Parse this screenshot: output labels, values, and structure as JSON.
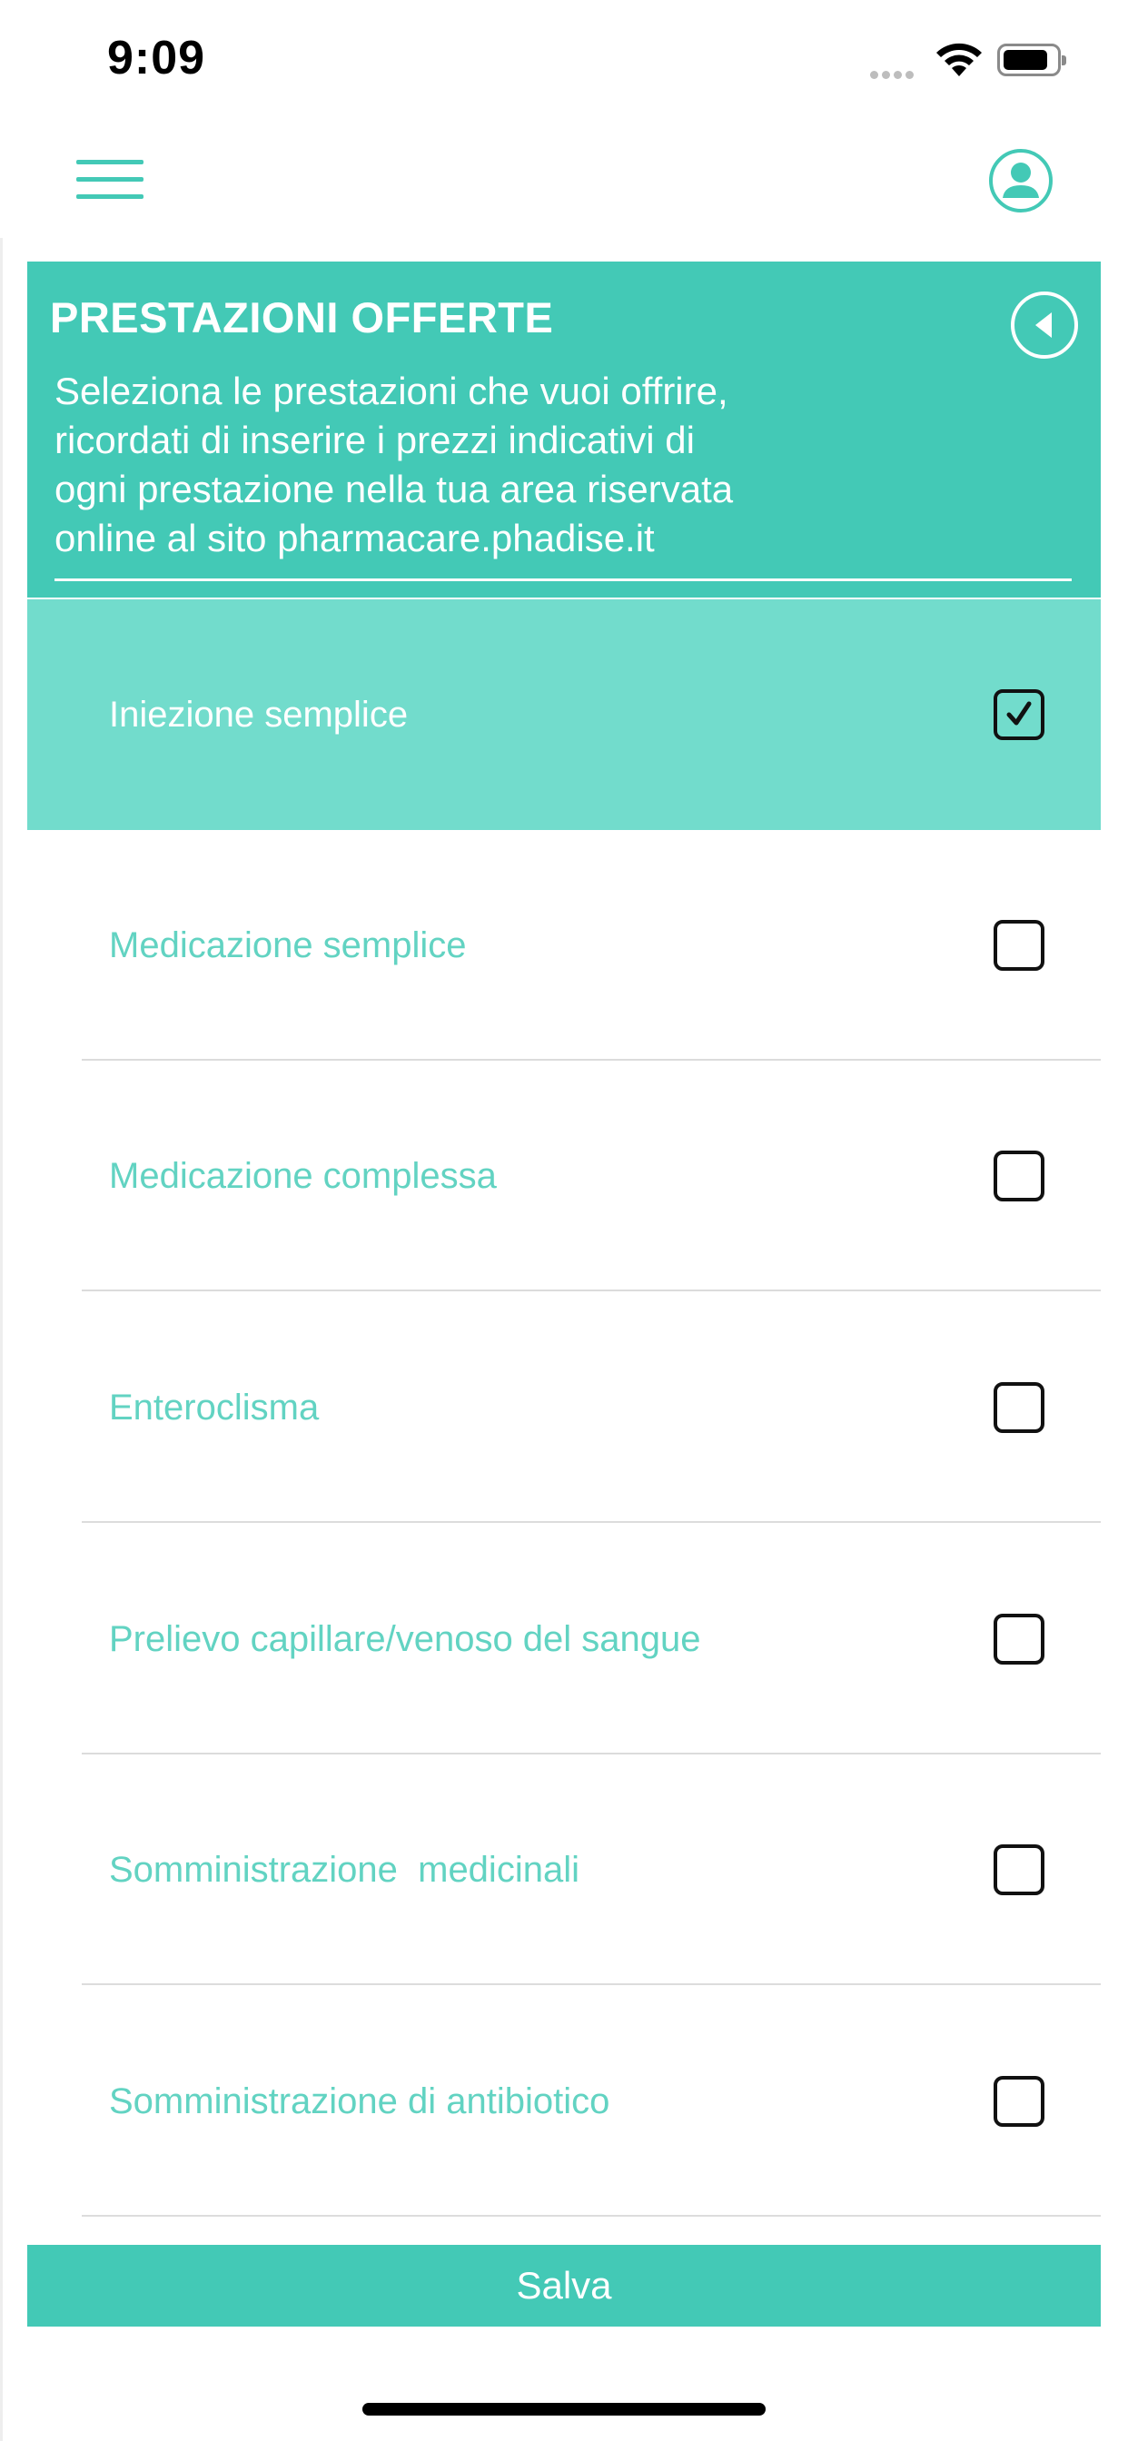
{
  "status_bar": {
    "time": "9:09"
  },
  "header": {
    "title": "PRESTAZIONI OFFERTE",
    "description": "Seleziona le prestazioni che vuoi offrire,\nricordati di inserire i prezzi indicativi di\nogni prestazione nella tua area riservata\nonline al sito pharmacare.phadise.it"
  },
  "services": [
    {
      "label": "Iniezione semplice",
      "checked": true
    },
    {
      "label": "Medicazione semplice",
      "checked": false
    },
    {
      "label": "Medicazione complessa",
      "checked": false
    },
    {
      "label": "Enteroclisma",
      "checked": false
    },
    {
      "label": "Prelievo capillare/venoso del sangue",
      "checked": false
    },
    {
      "label": "Somministrazione  medicinali",
      "checked": false
    },
    {
      "label": "Somministrazione di antibiotico",
      "checked": false
    }
  ],
  "footer": {
    "save_label": "Salva"
  },
  "colors": {
    "accent": "#43c9b6",
    "selected_row": "#72dccc",
    "label_text": "#62d3c2"
  },
  "icons": {
    "menu": "hamburger-icon",
    "profile": "user-icon",
    "back": "back-arrow-icon",
    "check": "checkmark-icon"
  }
}
